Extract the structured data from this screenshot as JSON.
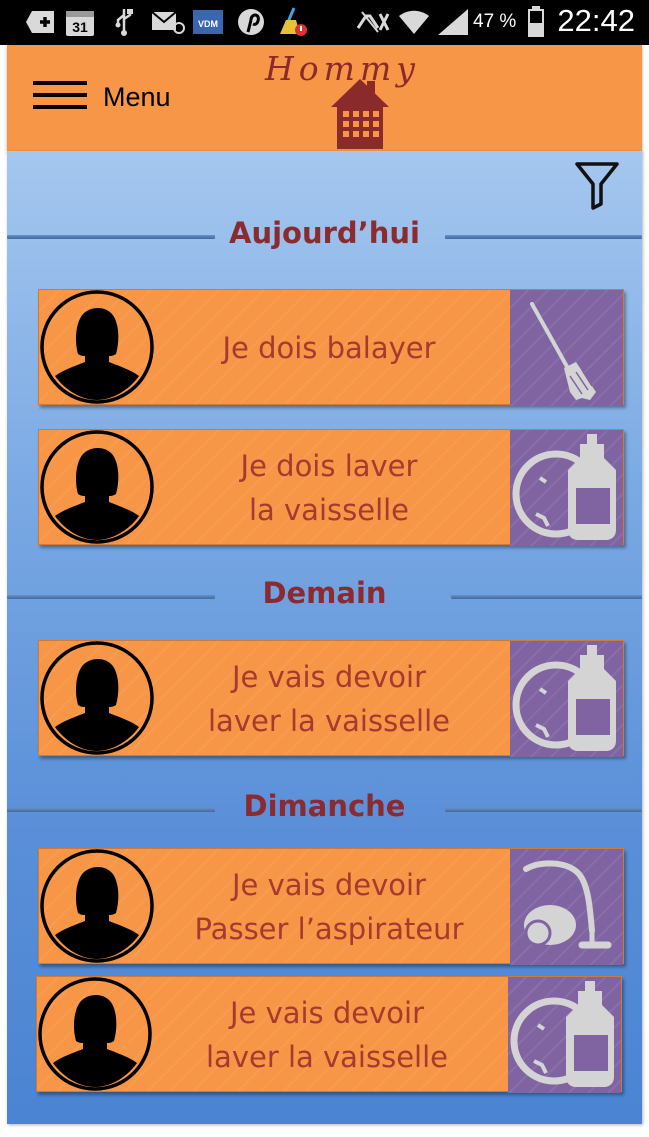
{
  "status_bar": {
    "time": "22:42",
    "battery_percent": "47 %",
    "calendar_day": "31",
    "vdm_label": "VDM",
    "icons": [
      "add-icon",
      "calendar-icon",
      "usb-icon",
      "mail-icon",
      "vdm-icon",
      "pinterest-icon",
      "cleaner-icon",
      "mute-icon",
      "wifi-icon",
      "signal-icon",
      "battery-icon"
    ]
  },
  "header": {
    "menu_label": "Menu",
    "logo_text": "Hommy",
    "accent_color": "#f79646",
    "logo_color": "#8b2a2a"
  },
  "sections": [
    {
      "title": "Aujourd’hui",
      "tasks": [
        {
          "line1": "Je dois balayer",
          "line2": "",
          "icon": "broom-icon"
        },
        {
          "line1": "Je dois laver",
          "line2": "la vaisselle",
          "icon": "dish-soap-icon"
        }
      ]
    },
    {
      "title": "Demain",
      "tasks": [
        {
          "line1": "Je vais devoir",
          "line2": "laver la vaisselle",
          "icon": "dish-soap-icon"
        }
      ]
    },
    {
      "title": "Dimanche",
      "tasks": [
        {
          "line1": "Je vais devoir",
          "line2": "Passer l’aspirateur",
          "icon": "vacuum-icon"
        },
        {
          "line1": "Je vais devoir",
          "line2": "laver la vaisselle",
          "icon": "dish-soap-icon"
        }
      ]
    }
  ],
  "colors": {
    "card": "#f79646",
    "chore_tile": "#8064a2",
    "task_text": "#a63a2e",
    "section_title": "#8b2a2f"
  }
}
